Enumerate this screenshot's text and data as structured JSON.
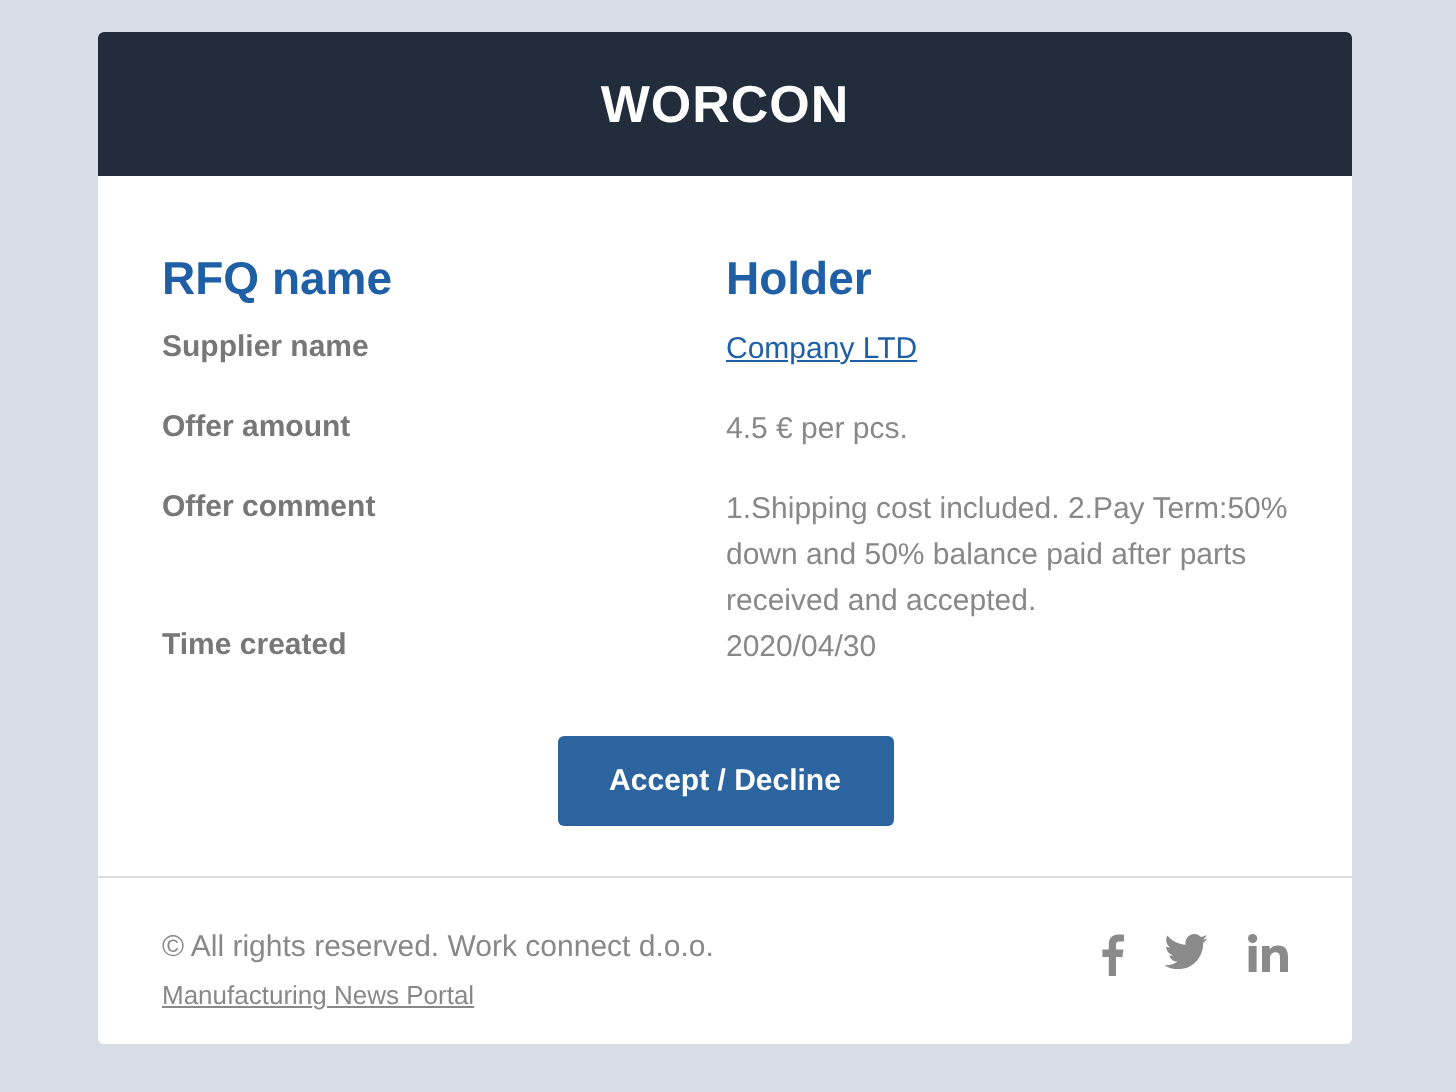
{
  "logo": {
    "text": "WORCON"
  },
  "heading": {
    "label": "RFQ name",
    "value": "Holder"
  },
  "rows": [
    {
      "label": "Supplier name",
      "value": "Company LTD",
      "kind": "link"
    },
    {
      "label": "Offer amount",
      "value": "4.5 € per pcs.",
      "kind": "text"
    },
    {
      "label": "Offer comment",
      "value": "1.Shipping cost included. 2.Pay Term:50% down and 50% balance paid after parts received and accepted.",
      "kind": "text"
    },
    {
      "label": "Time created",
      "value": "2020/04/30",
      "kind": "text"
    }
  ],
  "button": "Accept / Decline",
  "footer": {
    "copyright": "© All rights reserved. Work connect d.o.o.",
    "link": "Manufacturing News Portal"
  }
}
